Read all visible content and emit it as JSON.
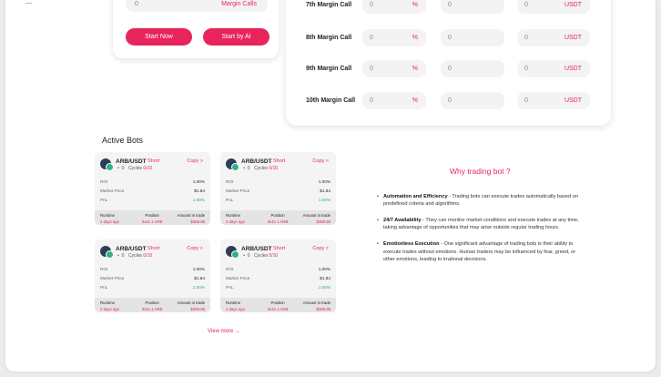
{
  "strategy": {
    "margin_field": {
      "value": "0",
      "unit": "Margin Calls"
    },
    "start_now_label": "Start Now",
    "start_ai_label": "Start by AI"
  },
  "margin_calls": [
    {
      "label": "7th Margin Call",
      "price": "0",
      "price_unit": "%",
      "amount": "0",
      "total": "0",
      "total_unit": "USDT"
    },
    {
      "label": "8th Margin Call",
      "price": "0",
      "price_unit": "%",
      "amount": "0",
      "total": "0",
      "total_unit": "USDT"
    },
    {
      "label": "9th Margin Call",
      "price": "0",
      "price_unit": "%",
      "amount": "0",
      "total": "0",
      "total_unit": "USDT"
    },
    {
      "label": "10th Margin Call",
      "price": "0",
      "price_unit": "%",
      "amount": "0",
      "total": "0",
      "total_unit": "USDT"
    }
  ],
  "active_bots": {
    "title": "Active Bots",
    "bots": [
      {
        "pair": "ARB/USDT",
        "side": "Short",
        "copy": "Copy >",
        "users": "0",
        "cycles_label": "Cycles",
        "cycles": "0/10",
        "roi_label": "ROI",
        "roi": "1.00%",
        "market_label": "Market Price",
        "market": "$1.84",
        "pnl_label": "PnL",
        "pnl": "1.00%",
        "runtime_label": "Runtime",
        "runtime": "2 days ago",
        "position_label": "Position",
        "position": "8x11.1 ARB",
        "amount_label": "Amount in trade",
        "amount": "$389.88"
      },
      {
        "pair": "ARB/USDT",
        "side": "Short",
        "copy": "Copy >",
        "users": "0",
        "cycles_label": "Cycles",
        "cycles": "0/10",
        "roi_label": "ROI",
        "roi": "1.00%",
        "market_label": "Market Price",
        "market": "$1.84",
        "pnl_label": "PnL",
        "pnl": "1.00%",
        "runtime_label": "Runtime",
        "runtime": "2 days ago",
        "position_label": "Position",
        "position": "8x11.1 ARB",
        "amount_label": "Amount in trade",
        "amount": "$389.88"
      },
      {
        "pair": "ARB/USDT",
        "side": "Short",
        "copy": "Copy >",
        "users": "0",
        "cycles_label": "Cycles",
        "cycles": "0/10",
        "roi_label": "ROI",
        "roi": "1.00%",
        "market_label": "Market Price",
        "market": "$1.84",
        "pnl_label": "PnL",
        "pnl": "1.00%",
        "runtime_label": "Runtime",
        "runtime": "2 days ago",
        "position_label": "Position",
        "position": "8x11.1 ARB",
        "amount_label": "Amount in trade",
        "amount": "$389.88"
      },
      {
        "pair": "ARB/USDT",
        "side": "Short",
        "copy": "Copy >",
        "users": "0",
        "cycles_label": "Cycles",
        "cycles": "0/10",
        "roi_label": "ROI",
        "roi": "1.00%",
        "market_label": "Market Price",
        "market": "$1.84",
        "pnl_label": "PnL",
        "pnl": "1.00%",
        "runtime_label": "Runtime",
        "runtime": "2 days ago",
        "position_label": "Position",
        "position": "8x11.1 ARB",
        "amount_label": "Amount in trade",
        "amount": "$389.88"
      }
    ],
    "view_more": "View more →"
  },
  "why": {
    "title": "Why trading bot ?",
    "points": [
      {
        "heading": "Automation and Efficiency",
        "text": " - Trading bots can execute trades automatically based on predefined criteria and algorithms."
      },
      {
        "heading": "24/7 Availability",
        "text": " - They can monitor market conditions and execute trades at any time, taking advantage of opportunities that may arise outside regular trading hours."
      },
      {
        "heading": "Emotionless Execution",
        "text": " - One significant advantage of trading bots is their ability to execute trades without emotions. Human traders may be influenced by fear, greed, or other emotions, leading to irrational decisions."
      }
    ]
  },
  "colors": {
    "accent": "#e8245d",
    "positive": "#23b463"
  }
}
